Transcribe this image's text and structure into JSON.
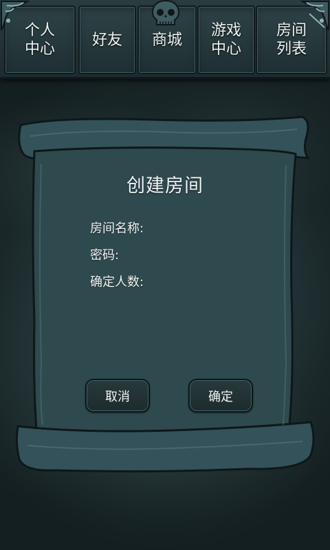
{
  "tabs": [
    {
      "label": "个人\n中心"
    },
    {
      "label": "好友"
    },
    {
      "label": "商城"
    },
    {
      "label": "游戏\n中心"
    },
    {
      "label": "房间\n列表"
    }
  ],
  "dialog": {
    "title": "创建房间",
    "fields": [
      {
        "label": "房间名称:"
      },
      {
        "label": "密码:"
      },
      {
        "label": "确定人数:"
      }
    ],
    "cancel_label": "取消",
    "confirm_label": "确定"
  },
  "icons": {
    "header_emblem": "skull-icon",
    "corners": "ornament-icon"
  },
  "colors": {
    "background": "#243639",
    "panel": "#2f4a4e",
    "panel_border": "#0e1719",
    "text": "#f1f5f5"
  }
}
